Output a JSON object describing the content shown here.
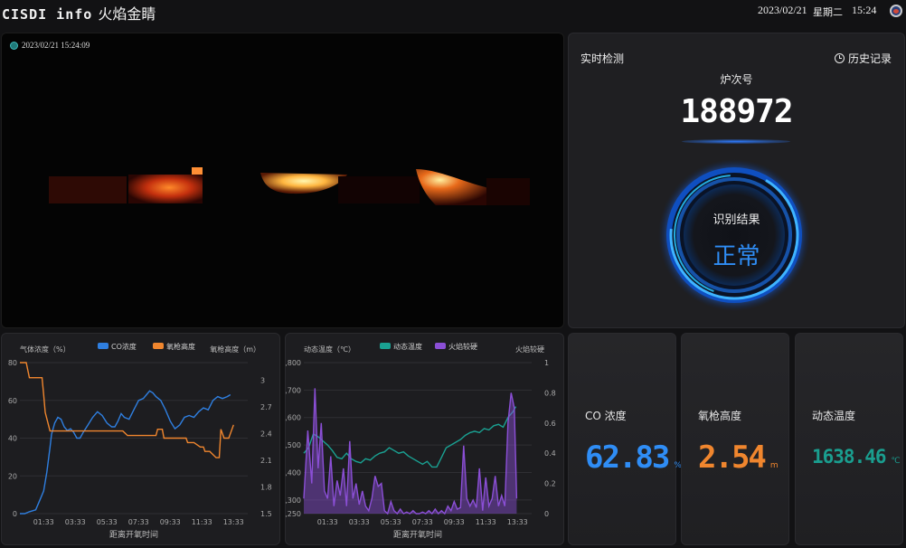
{
  "header": {
    "logo": "CISDI info",
    "title": "火焰金睛",
    "date": "2023/02/21",
    "weekday": "星期二",
    "time": "15:24"
  },
  "video": {
    "timestamp": "2023/02/21 15:24:09"
  },
  "detection": {
    "title": "实时检测",
    "history_label": "历史记录",
    "heat_label": "炉次号",
    "heat_number": "188972",
    "result_label": "识别结果",
    "result_value": "正常"
  },
  "metrics": [
    {
      "label": "CO 浓度",
      "value": "62.83",
      "unit": "%",
      "color": "#2f8df5"
    },
    {
      "label": "氧枪高度",
      "value": "2.54",
      "unit": "m",
      "color": "#f0862e"
    },
    {
      "label": "动态温度",
      "value": "1638.46",
      "unit": "℃",
      "color": "#1a9e8f"
    }
  ],
  "colors": {
    "co": "#2f7fe0",
    "lance": "#f0862e",
    "temp": "#1aa192",
    "flame": "#8b4fd6"
  },
  "chart_data": [
    {
      "type": "line",
      "left_axis_label": "气体浓度（%）",
      "right_axis_label": "氧枪高度（m）",
      "xlabel": "距离开氧时间",
      "x_ticks": [
        "01:33",
        "03:33",
        "05:33",
        "07:33",
        "09:33",
        "11:33",
        "13:33"
      ],
      "y_left_ticks": [
        "0",
        "20",
        "40",
        "60",
        "80"
      ],
      "y_right_ticks": [
        "1.5",
        "1.8",
        "2.1",
        "2.4",
        "2.7",
        "3"
      ],
      "ylim_left": [
        0,
        80
      ],
      "ylim_right": [
        1.5,
        3.2
      ],
      "xlim": [
        0,
        14.4
      ],
      "series": [
        {
          "name": "CO浓度",
          "axis": "left",
          "x": [
            0,
            0.3,
            0.6,
            1.0,
            1.3,
            1.5,
            1.7,
            1.9,
            2.0,
            2.2,
            2.4,
            2.6,
            2.8,
            3.0,
            3.2,
            3.4,
            3.6,
            3.8,
            4.0,
            4.3,
            4.6,
            4.9,
            5.2,
            5.5,
            5.8,
            6.0,
            6.2,
            6.4,
            6.6,
            6.9,
            7.2,
            7.5,
            7.8,
            8.0,
            8.2,
            8.4,
            8.6,
            8.9,
            9.2,
            9.5,
            9.8,
            10.1,
            10.4,
            10.7,
            11.0,
            11.3,
            11.6,
            11.9,
            12.2,
            12.5,
            12.8,
            13.1,
            13.3
          ],
          "values": [
            0,
            0,
            1,
            2,
            8,
            12,
            22,
            35,
            42,
            48,
            51,
            50,
            46,
            44,
            45,
            43,
            40,
            40,
            43,
            47,
            51,
            54,
            52,
            48,
            46,
            46,
            49,
            53,
            51,
            50,
            55,
            60,
            61,
            63,
            65,
            64,
            62,
            60,
            55,
            49,
            45,
            47,
            51,
            52,
            51,
            54,
            56,
            55,
            60,
            62,
            61,
            62,
            63
          ]
        },
        {
          "name": "氧枪高度",
          "axis": "right",
          "x": [
            0,
            0.4,
            0.6,
            1.4,
            1.5,
            1.6,
            1.9,
            2.6,
            3.0,
            4.0,
            5.0,
            6.0,
            6.5,
            6.8,
            7.2,
            7.6,
            7.8,
            8.0,
            8.6,
            8.7,
            9.0,
            9.1,
            9.5,
            10.0,
            10.5,
            10.6,
            11.0,
            11.4,
            11.6,
            11.7,
            12.0,
            12.4,
            12.6,
            12.7,
            12.9,
            13.2,
            13.5
          ],
          "values": [
            3.2,
            3.2,
            3.03,
            3.03,
            2.84,
            2.64,
            2.43,
            2.43,
            2.43,
            2.43,
            2.43,
            2.43,
            2.43,
            2.38,
            2.38,
            2.38,
            2.38,
            2.38,
            2.38,
            2.45,
            2.45,
            2.35,
            2.35,
            2.35,
            2.35,
            2.3,
            2.3,
            2.25,
            2.25,
            2.2,
            2.2,
            2.13,
            2.13,
            2.45,
            2.35,
            2.35,
            2.5
          ]
        }
      ]
    },
    {
      "type": "line",
      "left_axis_label": "动态温度（℃）",
      "right_axis_label": "火焰较硬",
      "xlabel": "距离开氧时间",
      "x_ticks": [
        "01:33",
        "03:33",
        "05:33",
        "07:33",
        "09:33",
        "11:33",
        "13:33"
      ],
      "y_left_ticks": [
        "1,250",
        "1,300",
        "1,400",
        "1,500",
        "1,600",
        "1,700",
        "1,800"
      ],
      "y_right_ticks": [
        "0",
        "0.2",
        "0.4",
        "0.6",
        "0.8",
        "1"
      ],
      "ylim_left": [
        1250,
        1800
      ],
      "ylim_right": [
        0,
        1
      ],
      "xlim": [
        0,
        14.4
      ],
      "series": [
        {
          "name": "动态温度",
          "axis": "left",
          "x": [
            0,
            0.3,
            0.6,
            0.9,
            1.2,
            1.5,
            1.8,
            2.1,
            2.4,
            2.7,
            3.0,
            3.3,
            3.6,
            3.9,
            4.2,
            4.5,
            4.8,
            5.1,
            5.4,
            5.7,
            6.0,
            6.3,
            6.6,
            6.9,
            7.2,
            7.5,
            7.8,
            8.1,
            8.4,
            8.7,
            9.0,
            9.3,
            9.6,
            9.9,
            10.2,
            10.5,
            10.8,
            11.1,
            11.4,
            11.7,
            12.0,
            12.3,
            12.6,
            12.9,
            13.2,
            13.4
          ],
          "values": [
            1470,
            1490,
            1540,
            1530,
            1515,
            1500,
            1480,
            1455,
            1450,
            1470,
            1450,
            1440,
            1435,
            1450,
            1445,
            1460,
            1470,
            1475,
            1490,
            1480,
            1470,
            1475,
            1460,
            1450,
            1440,
            1430,
            1440,
            1420,
            1420,
            1455,
            1490,
            1500,
            1510,
            1520,
            1535,
            1545,
            1550,
            1545,
            1560,
            1555,
            1570,
            1575,
            1565,
            1600,
            1620,
            1640
          ]
        },
        {
          "name": "火焰较硬",
          "axis": "right",
          "x": [
            0,
            0.25,
            0.5,
            0.7,
            0.9,
            1.1,
            1.3,
            1.5,
            1.7,
            1.9,
            2.1,
            2.3,
            2.5,
            2.7,
            2.9,
            3.1,
            3.3,
            3.5,
            3.7,
            3.9,
            4.1,
            4.3,
            4.5,
            4.7,
            4.9,
            5.1,
            5.3,
            5.5,
            5.7,
            5.9,
            6.1,
            6.3,
            6.5,
            6.7,
            6.9,
            7.1,
            7.3,
            7.5,
            7.7,
            7.9,
            8.1,
            8.3,
            8.5,
            8.7,
            8.9,
            9.1,
            9.3,
            9.5,
            9.7,
            9.9,
            10.1,
            10.3,
            10.5,
            10.7,
            10.9,
            11.1,
            11.3,
            11.5,
            11.7,
            11.9,
            12.1,
            12.3,
            12.5,
            12.7,
            12.9,
            13.1,
            13.3,
            13.45
          ],
          "values": [
            0.1,
            0.55,
            0.2,
            0.83,
            0.3,
            0.6,
            0.15,
            0.1,
            0.38,
            0.05,
            0.22,
            0.12,
            0.3,
            0.05,
            0.48,
            0.1,
            0.2,
            0.06,
            0.15,
            0.05,
            0.02,
            0.1,
            0.25,
            0.18,
            0.2,
            0.02,
            0.0,
            0.08,
            0.02,
            0.0,
            0.03,
            0.0,
            0.01,
            0.0,
            0.02,
            0.0,
            0.0,
            0.01,
            0.0,
            0.02,
            0.0,
            0.03,
            0.0,
            0.02,
            0.0,
            0.05,
            0.02,
            0.08,
            0.03,
            0.04,
            0.45,
            0.1,
            0.05,
            0.09,
            0.04,
            0.3,
            0.02,
            0.24,
            0.05,
            0.1,
            0.25,
            0.05,
            0.12,
            0.05,
            0.6,
            0.8,
            0.7,
            0.1
          ]
        }
      ]
    }
  ]
}
